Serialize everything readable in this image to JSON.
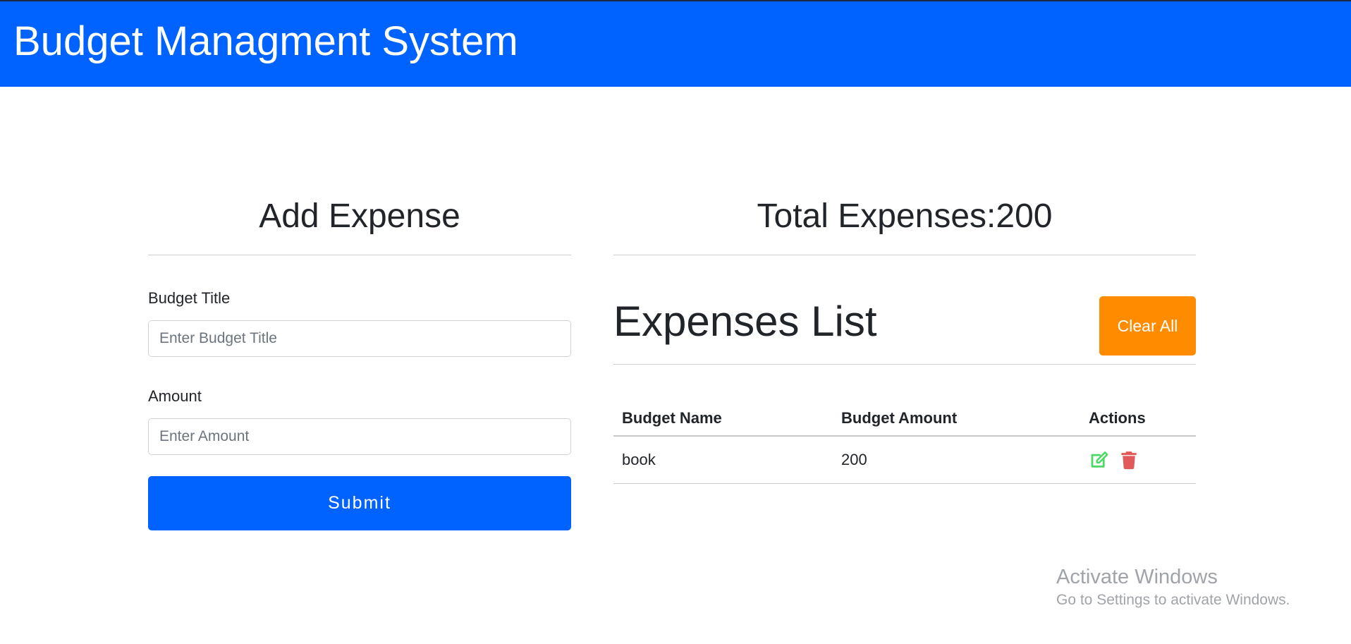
{
  "navbar": {
    "brand": "Budget Managment System",
    "bg_color": "#0062ff"
  },
  "add_expense": {
    "heading": "Add Expense",
    "title_label": "Budget Title",
    "title_placeholder": "Enter Budget Title",
    "title_value": "",
    "amount_label": "Amount",
    "amount_placeholder": "Enter Amount",
    "amount_value": "",
    "submit_label": "Submit"
  },
  "summary": {
    "total_label": "Total Expenses:200"
  },
  "expenses_list": {
    "heading": "Expenses List",
    "clear_label": "Clear All",
    "clear_color": "#ff8c00",
    "columns": [
      "Budget Name",
      "Budget Amount",
      "Actions"
    ],
    "rows": [
      {
        "name": "book",
        "amount": "200",
        "actions": [
          "edit-icon",
          "trash-icon"
        ]
      }
    ],
    "edit_icon_color": "#4cd964",
    "delete_icon_color": "#e05a5a"
  },
  "watermark": {
    "title": "Activate Windows",
    "subtitle": "Go to Settings to activate Windows."
  }
}
